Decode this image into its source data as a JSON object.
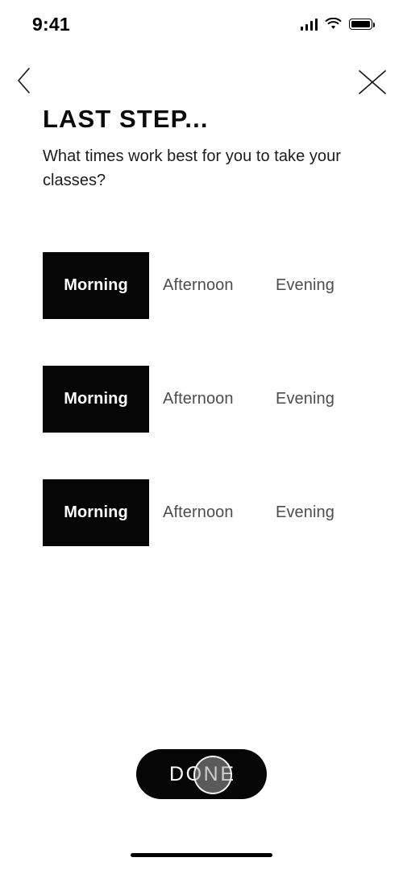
{
  "status_bar": {
    "time": "9:41",
    "signal_icon": "cellular-signal-icon",
    "wifi_icon": "wifi-icon",
    "battery_icon": "battery-full-icon"
  },
  "nav": {
    "back_icon": "chevron-left-icon",
    "close_icon": "close-x-icon"
  },
  "heading": {
    "title": "LAST STEP...",
    "subtitle": "What times work best for you to take your classes?"
  },
  "options": {
    "rows": [
      {
        "choices": [
          {
            "label": "Morning",
            "selected": true
          },
          {
            "label": "Afternoon",
            "selected": false
          },
          {
            "label": "Evening",
            "selected": false
          }
        ]
      },
      {
        "choices": [
          {
            "label": "Morning",
            "selected": true
          },
          {
            "label": "Afternoon",
            "selected": false
          },
          {
            "label": "Evening",
            "selected": false
          }
        ]
      },
      {
        "choices": [
          {
            "label": "Morning",
            "selected": true
          },
          {
            "label": "Afternoon",
            "selected": false
          },
          {
            "label": "Evening",
            "selected": false
          }
        ]
      }
    ]
  },
  "footer": {
    "done_label": "DONE",
    "cursor_icon": "tap-cursor-indicator"
  },
  "colors": {
    "background": "#ffffff",
    "selected_fill": "#050505",
    "selected_text": "#ffffff",
    "unselected_text": "#4d4d4d",
    "title_text": "#0b0b0b",
    "subtitle_text": "#1c1c1c",
    "button_fill": "#060606"
  }
}
